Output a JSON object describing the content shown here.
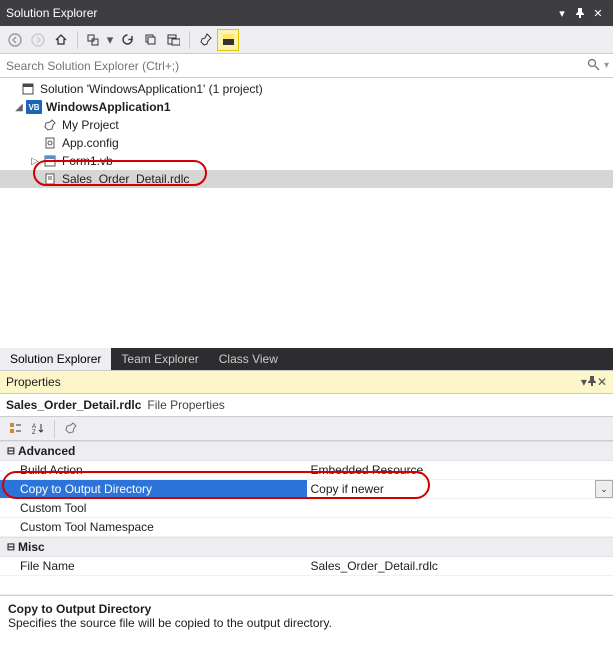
{
  "solutionExplorer": {
    "title": "Solution Explorer",
    "searchPlaceholder": "Search Solution Explorer (Ctrl+;)",
    "solutionLabel": "Solution 'WindowsApplication1' (1 project)",
    "projectName": "WindowsApplication1",
    "items": {
      "myProject": "My Project",
      "appConfig": "App.config",
      "form1": "Form1.vb",
      "report": "Sales_Order_Detail.rdlc"
    }
  },
  "tabs": {
    "solutionExplorer": "Solution Explorer",
    "teamExplorer": "Team Explorer",
    "classView": "Class View"
  },
  "properties": {
    "title": "Properties",
    "objectName": "Sales_Order_Detail.rdlc",
    "objectType": "File Properties",
    "categories": {
      "advanced": "Advanced",
      "misc": "Misc"
    },
    "rows": {
      "buildAction": {
        "label": "Build Action",
        "value": "Embedded Resource"
      },
      "copyToOutput": {
        "label": "Copy to Output Directory",
        "value": "Copy if newer"
      },
      "customTool": {
        "label": "Custom Tool",
        "value": ""
      },
      "customToolNs": {
        "label": "Custom Tool Namespace",
        "value": ""
      },
      "fileName": {
        "label": "File Name",
        "value": "Sales_Order_Detail.rdlc"
      }
    },
    "description": {
      "title": "Copy to Output Directory",
      "text": "Specifies the source file will be copied to the output directory."
    }
  }
}
